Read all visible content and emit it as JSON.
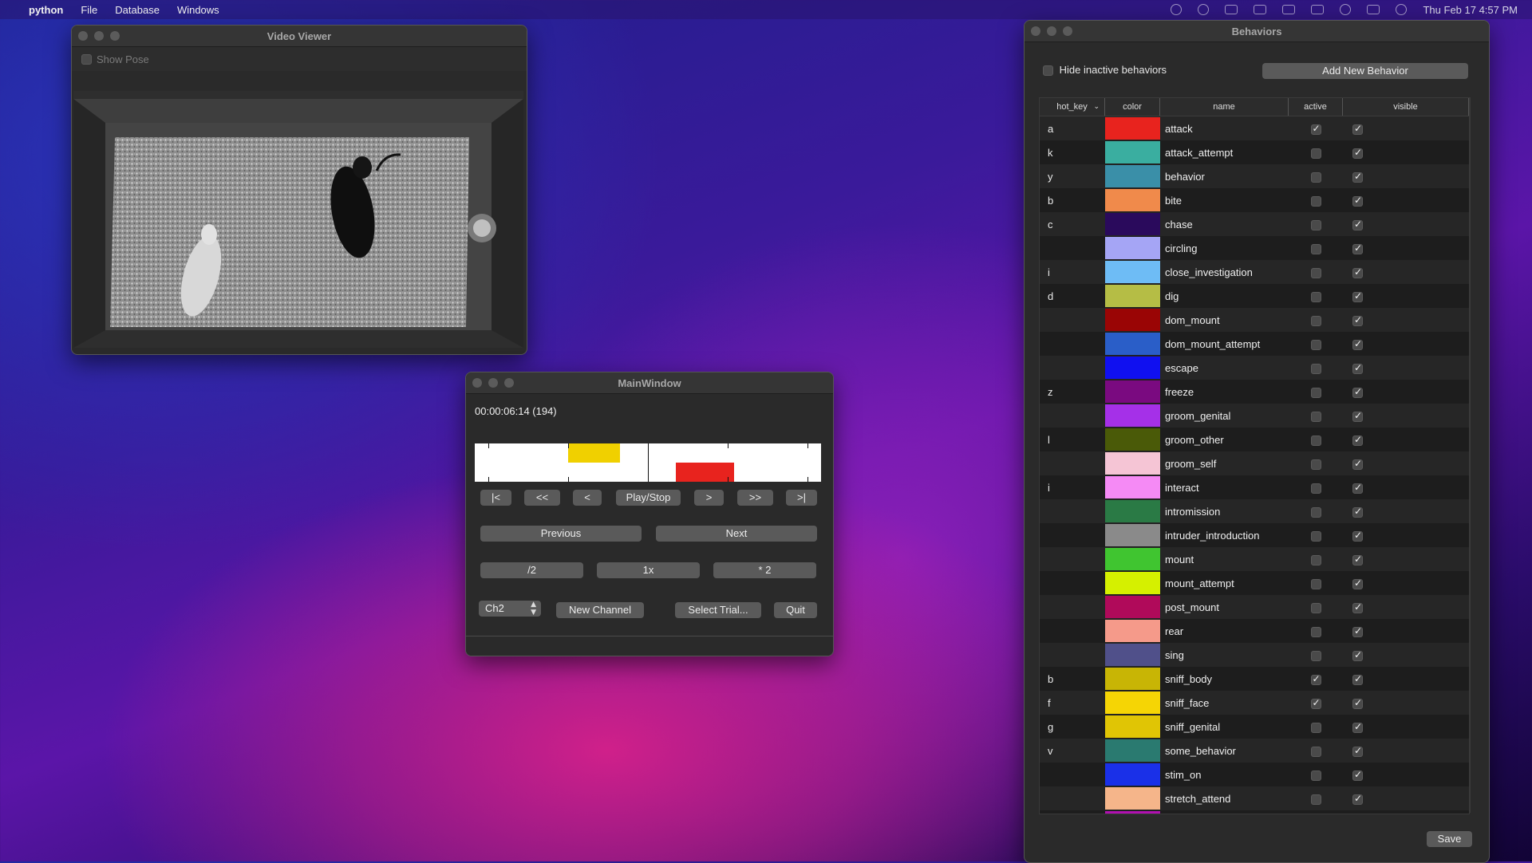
{
  "menubar": {
    "app": "python",
    "items": [
      "File",
      "Database",
      "Windows"
    ],
    "clock": "Thu Feb 17  4:57 PM"
  },
  "video_viewer": {
    "title": "Video Viewer",
    "show_pose_label": "Show Pose",
    "show_pose_checked": false
  },
  "main_window": {
    "title": "MainWindow",
    "timecode": "00:00:06:14 (194)",
    "timeline": {
      "current_position_fraction": 0.5,
      "top_track": [
        {
          "start": 0.27,
          "end": 0.42,
          "color": "#f0d000"
        }
      ],
      "bottom_track": [
        {
          "start": 0.58,
          "end": 0.75,
          "color": "#e8231e"
        }
      ]
    },
    "transport": [
      "|<",
      "<<",
      "<",
      "Play/Stop",
      ">",
      ">>",
      ">|"
    ],
    "nav": {
      "previous": "Previous",
      "next": "Next"
    },
    "speed": {
      "half": "/2",
      "normal": "1x",
      "double": "* 2"
    },
    "channel_select": "Ch2",
    "new_channel": "New Channel",
    "select_trial": "Select Trial...",
    "quit": "Quit"
  },
  "behaviors": {
    "title": "Behaviors",
    "hide_inactive_label": "Hide inactive behaviors",
    "hide_inactive_checked": false,
    "add_new": "Add New Behavior",
    "save": "Save",
    "columns": {
      "hot_key": "hot_key",
      "color": "color",
      "name": "name",
      "active": "active",
      "visible": "visible"
    },
    "rows": [
      {
        "hot_key": "a",
        "color": "#e8231e",
        "name": "attack",
        "active": true,
        "visible": true
      },
      {
        "hot_key": "k",
        "color": "#3aaea0",
        "name": "attack_attempt",
        "active": false,
        "visible": true
      },
      {
        "hot_key": "y",
        "color": "#3a8fa8",
        "name": "behavior",
        "active": false,
        "visible": true
      },
      {
        "hot_key": "b",
        "color": "#f08a4b",
        "name": "bite",
        "active": false,
        "visible": true
      },
      {
        "hot_key": "c",
        "color": "#2a0a5c",
        "name": "chase",
        "active": false,
        "visible": true
      },
      {
        "hot_key": "",
        "color": "#a5a5f5",
        "name": "circling",
        "active": false,
        "visible": true
      },
      {
        "hot_key": "i",
        "color": "#6ebcf5",
        "name": "close_investigation",
        "active": false,
        "visible": true
      },
      {
        "hot_key": "d",
        "color": "#b5bd45",
        "name": "dig",
        "active": false,
        "visible": true
      },
      {
        "hot_key": "",
        "color": "#9a0505",
        "name": "dom_mount",
        "active": false,
        "visible": true
      },
      {
        "hot_key": "",
        "color": "#2a5ec8",
        "name": "dom_mount_attempt",
        "active": false,
        "visible": true
      },
      {
        "hot_key": "",
        "color": "#1010f0",
        "name": "escape",
        "active": false,
        "visible": true
      },
      {
        "hot_key": "z",
        "color": "#7a0a80",
        "name": "freeze",
        "active": false,
        "visible": true
      },
      {
        "hot_key": "",
        "color": "#a530e8",
        "name": "groom_genital",
        "active": false,
        "visible": true
      },
      {
        "hot_key": "l",
        "color": "#4a5a08",
        "name": "groom_other",
        "active": false,
        "visible": true
      },
      {
        "hot_key": "",
        "color": "#f5c5d5",
        "name": "groom_self",
        "active": false,
        "visible": true
      },
      {
        "hot_key": "i",
        "color": "#f58af5",
        "name": "interact",
        "active": false,
        "visible": true
      },
      {
        "hot_key": "",
        "color": "#2a7a45",
        "name": "intromission",
        "active": false,
        "visible": true
      },
      {
        "hot_key": "",
        "color": "#8a8a8a",
        "name": "intruder_introduction",
        "active": false,
        "visible": true
      },
      {
        "hot_key": "",
        "color": "#40c530",
        "name": "mount",
        "active": false,
        "visible": true
      },
      {
        "hot_key": "",
        "color": "#d5f000",
        "name": "mount_attempt",
        "active": false,
        "visible": true
      },
      {
        "hot_key": "",
        "color": "#b00a5a",
        "name": "post_mount",
        "active": false,
        "visible": true
      },
      {
        "hot_key": "",
        "color": "#f59a8a",
        "name": "rear",
        "active": false,
        "visible": true
      },
      {
        "hot_key": "",
        "color": "#50508a",
        "name": "sing",
        "active": false,
        "visible": true
      },
      {
        "hot_key": "b",
        "color": "#c8b505",
        "name": "sniff_body",
        "active": true,
        "visible": true
      },
      {
        "hot_key": "f",
        "color": "#f5d505",
        "name": "sniff_face",
        "active": true,
        "visible": true
      },
      {
        "hot_key": "g",
        "color": "#e0c505",
        "name": "sniff_genital",
        "active": false,
        "visible": true
      },
      {
        "hot_key": "v",
        "color": "#2a7a70",
        "name": "some_behavior",
        "active": false,
        "visible": true
      },
      {
        "hot_key": "",
        "color": "#1a30e8",
        "name": "stim_on",
        "active": false,
        "visible": true
      },
      {
        "hot_key": "",
        "color": "#f5b58a",
        "name": "stretch_attend",
        "active": false,
        "visible": true
      },
      {
        "hot_key": "",
        "color": "#b010b0",
        "name": "",
        "active": false,
        "visible": true
      }
    ]
  }
}
